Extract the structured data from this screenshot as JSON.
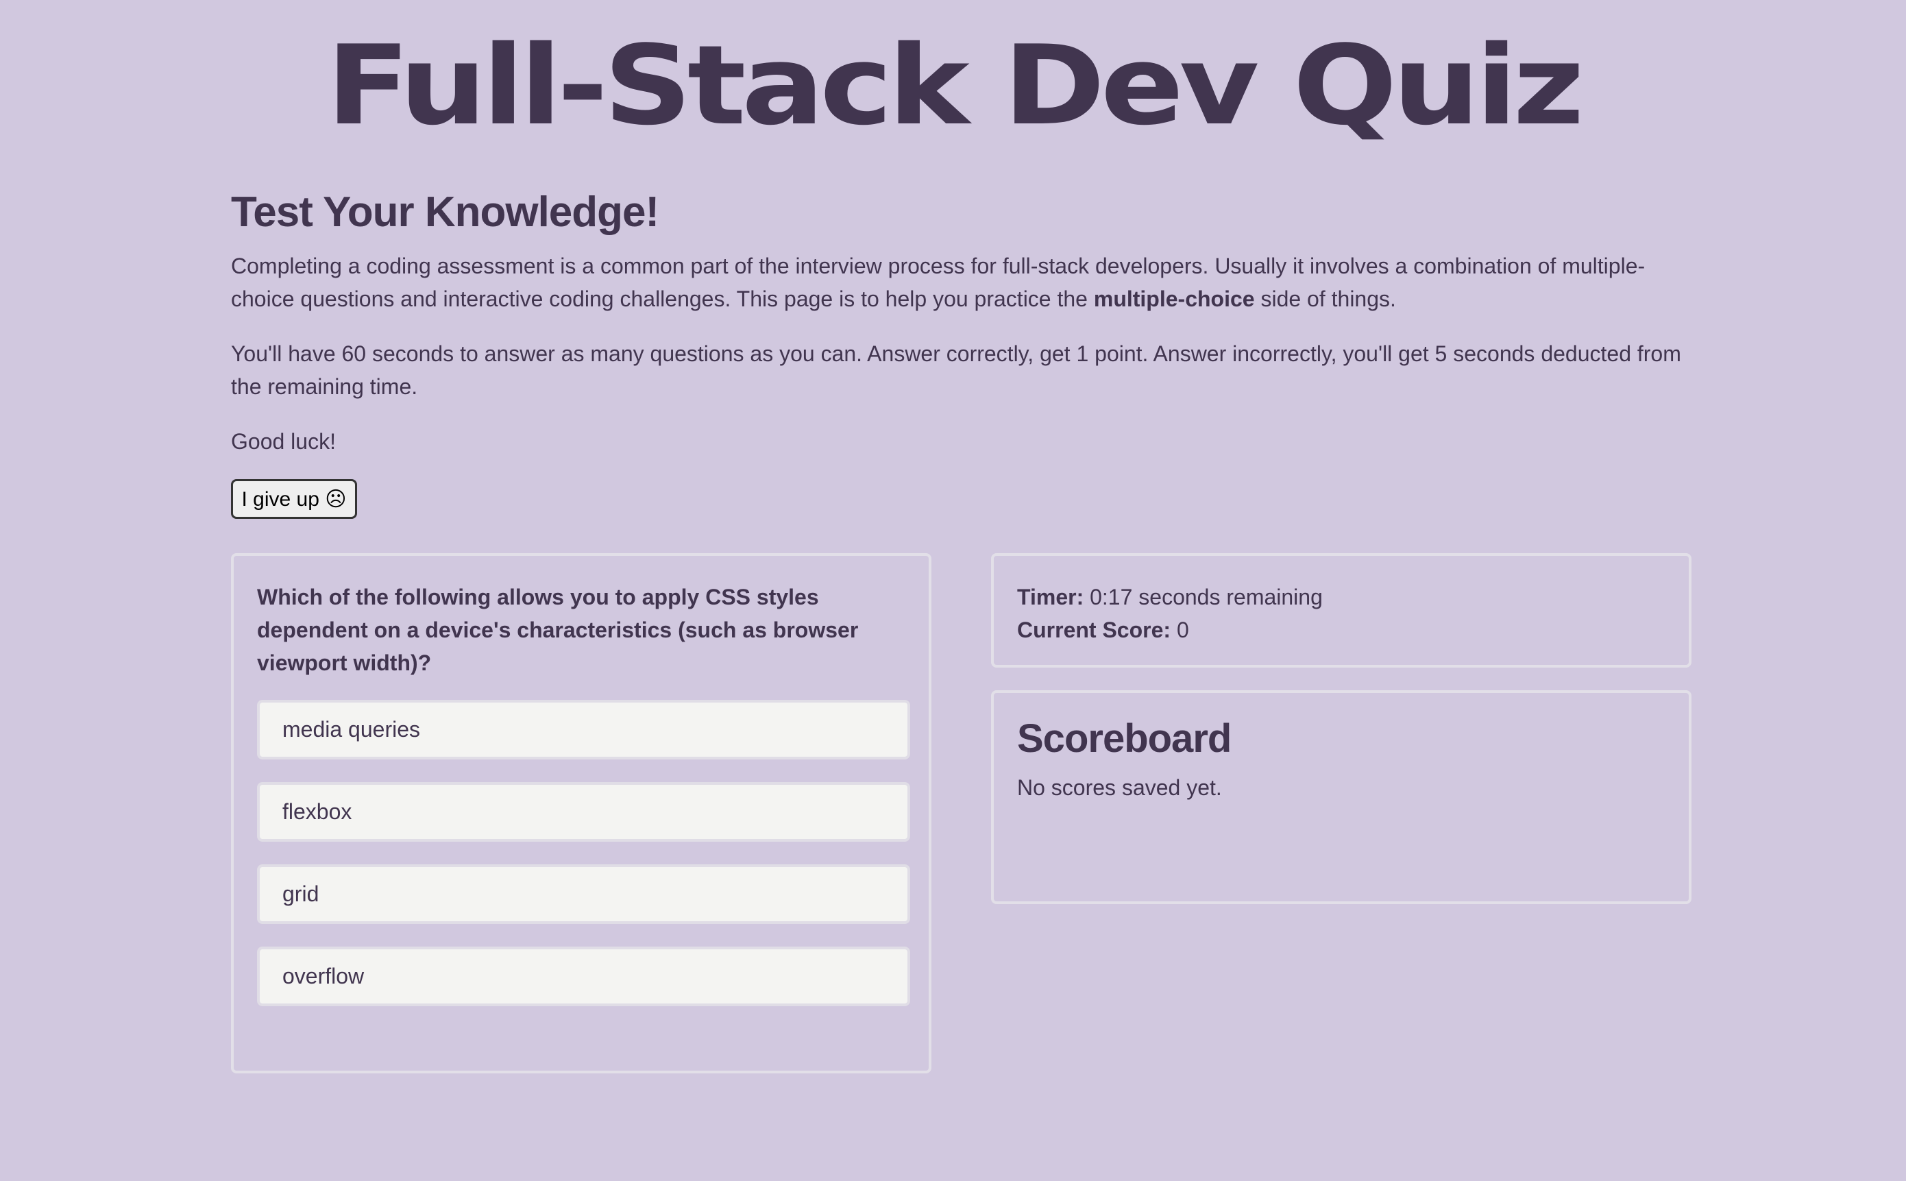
{
  "page": {
    "title": "Full-Stack Dev Quiz"
  },
  "intro": {
    "heading": "Test Your Knowledge!",
    "paragraph1_part1": "Completing a coding assessment is a common part of the interview process for full-stack developers. Usually it involves a combination of multiple-choice questions and interactive coding challenges. This page is to help you practice the ",
    "paragraph1_bold": "multiple-choice",
    "paragraph1_part2": " side of things.",
    "paragraph2": "You'll have 60 seconds to answer as many questions as you can. Answer correctly, get 1 point. Answer incorrectly, you'll get 5 seconds deducted from the remaining time.",
    "paragraph3": "Good luck!"
  },
  "controls": {
    "give_up_label": "I give up ☹"
  },
  "question": {
    "text": "Which of the following allows you to apply CSS styles dependent on a device's characteristics (such as browser viewport width)?",
    "answers": [
      "media queries",
      "flexbox",
      "grid",
      "overflow"
    ]
  },
  "status": {
    "timer_label": "Timer:",
    "timer_value": "0:17 seconds remaining",
    "score_label": "Current Score:",
    "score_value": "0"
  },
  "scoreboard": {
    "heading": "Scoreboard",
    "empty_message": "No scores saved yet."
  },
  "colors": {
    "background": "#d1c8df",
    "text": "#41354f",
    "card_border": "#e2dfe8",
    "answer_background": "#f4f4f2"
  }
}
